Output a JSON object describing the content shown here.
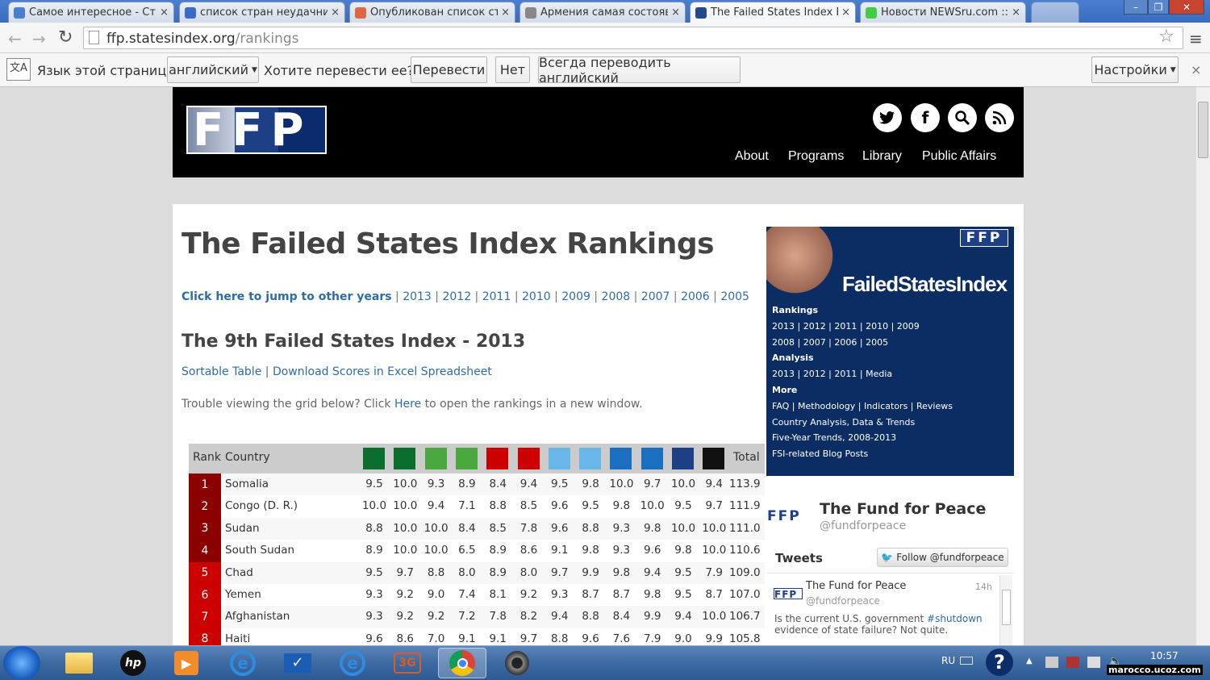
{
  "browser": {
    "tabs": [
      {
        "title": "Самое интересное - Стр"
      },
      {
        "title": "список стран неудачник"
      },
      {
        "title": "Опубликован список стр"
      },
      {
        "title": "Армения самая состоявш"
      },
      {
        "title": "The Failed States Index Ra"
      },
      {
        "title": "Новости NEWSru.com :: F"
      }
    ],
    "close_glyph": "×",
    "url_domain": "ffp.statesindex.org",
    "url_path": "/rankings"
  },
  "translate_bar": {
    "prompt_lang": "Язык этой страницы",
    "lang_select": "английский",
    "question": "Хотите перевести ее?",
    "translate_btn": "Перевести",
    "no_btn": "Нет",
    "always_btn": "Всегда переводить английский",
    "settings_btn": "Настройки"
  },
  "site": {
    "logo": "FFP",
    "nav": [
      "About",
      "Programs",
      "Library",
      "Public Affairs"
    ],
    "social_icons": [
      "twitter-icon",
      "facebook-icon",
      "search-icon",
      "rss-icon"
    ]
  },
  "page": {
    "title": "The Failed States Index Rankings",
    "jump_label": "Click here to jump to other years",
    "years": [
      "2013",
      "2012",
      "2011",
      "2010",
      "2009",
      "2008",
      "2007",
      "2006",
      "2005"
    ],
    "subtitle": "The 9th Failed States Index - 2013",
    "sortable": "Sortable Table",
    "download": "Download Scores in Excel Spreadsheet",
    "trouble_pre": "Trouble viewing the grid below? Click ",
    "trouble_link": "Here",
    "trouble_post": " to open the rankings in a new window."
  },
  "table": {
    "headers": {
      "rank": "Rank",
      "country": "Country",
      "total": "Total"
    },
    "indicator_icons": [
      "demographic-pressures-icon",
      "refugees-icon",
      "group-grievance-icon",
      "human-flight-icon",
      "uneven-development-icon",
      "economic-decline-icon",
      "state-legitimacy-icon",
      "public-services-icon",
      "human-rights-icon",
      "security-apparatus-icon",
      "factionalized-elites-icon",
      "external-intervention-icon"
    ],
    "rows": [
      {
        "rank": "1",
        "country": "Somalia",
        "scores": [
          "9.5",
          "10.0",
          "9.3",
          "8.9",
          "8.4",
          "9.4",
          "9.5",
          "9.8",
          "10.0",
          "9.7",
          "10.0",
          "9.4"
        ],
        "total": "113.9"
      },
      {
        "rank": "2",
        "country": "Congo (D. R.)",
        "scores": [
          "10.0",
          "10.0",
          "9.4",
          "7.1",
          "8.8",
          "8.5",
          "9.6",
          "9.5",
          "9.8",
          "10.0",
          "9.5",
          "9.7"
        ],
        "total": "111.9"
      },
      {
        "rank": "3",
        "country": "Sudan",
        "scores": [
          "8.8",
          "10.0",
          "10.0",
          "8.4",
          "8.5",
          "7.8",
          "9.6",
          "8.8",
          "9.3",
          "9.8",
          "10.0",
          "10.0"
        ],
        "total": "111.0"
      },
      {
        "rank": "4",
        "country": "South Sudan",
        "scores": [
          "8.9",
          "10.0",
          "10.0",
          "6.5",
          "8.9",
          "8.6",
          "9.1",
          "9.8",
          "9.3",
          "9.6",
          "9.8",
          "10.0"
        ],
        "total": "110.6"
      },
      {
        "rank": "5",
        "country": "Chad",
        "scores": [
          "9.5",
          "9.7",
          "8.8",
          "8.0",
          "8.9",
          "8.0",
          "9.7",
          "9.9",
          "9.8",
          "9.4",
          "9.5",
          "7.9"
        ],
        "total": "109.0"
      },
      {
        "rank": "6",
        "country": "Yemen",
        "scores": [
          "9.3",
          "9.2",
          "9.0",
          "7.4",
          "8.1",
          "9.2",
          "9.3",
          "8.7",
          "8.7",
          "9.8",
          "9.5",
          "8.7"
        ],
        "total": "107.0"
      },
      {
        "rank": "7",
        "country": "Afghanistan",
        "scores": [
          "9.3",
          "9.2",
          "9.2",
          "7.2",
          "7.8",
          "8.2",
          "9.4",
          "8.8",
          "8.4",
          "9.9",
          "9.4",
          "10.0"
        ],
        "total": "106.7"
      },
      {
        "rank": "8",
        "country": "Haiti",
        "scores": [
          "9.6",
          "8.6",
          "7.0",
          "9.1",
          "9.1",
          "9.7",
          "8.8",
          "9.6",
          "7.6",
          "7.9",
          "9.0",
          "9.9"
        ],
        "total": "105.8"
      }
    ],
    "colors": {
      "top": "#8b0000",
      "mid": "#cc0000"
    }
  },
  "sidebar": {
    "brand": "FailedStatesIndex",
    "logo": "FFP",
    "rankings_label": "Rankings",
    "rankings_line1": "2013 | 2012 | 2011 | 2010 | 2009",
    "rankings_line2": "2008 | 2007 | 2006 | 2005",
    "analysis_label": "Analysis",
    "analysis_line": "2013 | 2012 | 2011 | Media",
    "more_label": "More",
    "more_line1": "FAQ | Methodology | Indicators | Reviews",
    "more_line2": "Country Analysis, Data & Trends",
    "more_line3": "Five-Year Trends, 2008-2013",
    "more_line4": "FSI-related Blog Posts"
  },
  "twitter": {
    "logo": "FFP",
    "account_name": "The Fund for Peace",
    "handle": "@fundforpeace",
    "tweets_label": "Tweets",
    "follow_btn": "Follow @fundforpeace",
    "tweet": {
      "name": "The Fund for Peace",
      "handle": "@fundforpeace",
      "time": "14h",
      "text_pre": "Is the current U.S. government ",
      "hashtag": "#shutdown",
      "text_line2": "evidence of state failure? Not quite."
    }
  },
  "taskbar": {
    "lang": "RU",
    "clock": "10:57",
    "watermark": "marocco.ucoz.com"
  }
}
